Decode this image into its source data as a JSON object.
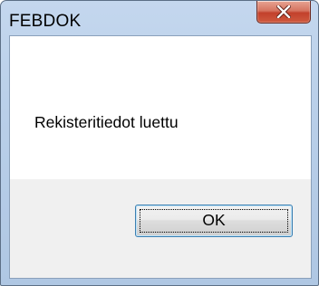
{
  "dialog": {
    "title": "FEBDOK",
    "message": "Rekisteritiedot luettu",
    "ok_label": "OK",
    "close_icon": "close-icon",
    "colors": {
      "frame": "#b9cfe9",
      "close_button": "#c2412c",
      "button_area": "#f0f0f0",
      "ok_border": "#3c7fb1"
    }
  }
}
